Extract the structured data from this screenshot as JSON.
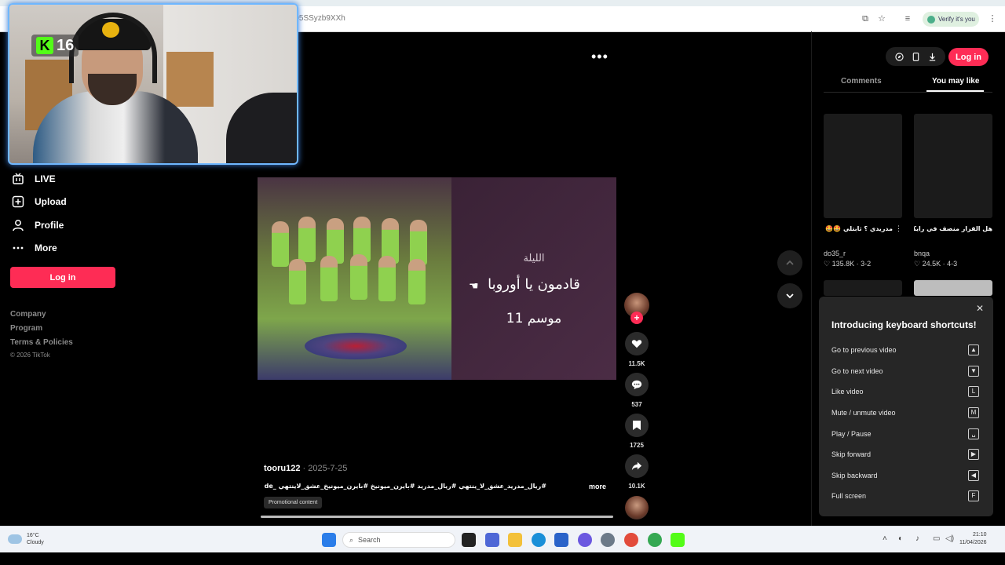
{
  "browser": {
    "url_fragment": "-95SSyzb9XXh",
    "verify_label": "Verify it's you"
  },
  "stream_overlay": {
    "platform_badge": "K",
    "viewer_count": "16"
  },
  "sidebar": {
    "items": [
      {
        "label": "LIVE",
        "icon": "live-tv-icon"
      },
      {
        "label": "Upload",
        "icon": "upload-plus-icon"
      },
      {
        "label": "Profile",
        "icon": "profile-user-icon"
      },
      {
        "label": "More",
        "icon": "more-dots-icon"
      }
    ],
    "login_label": "Log in",
    "footer_links": [
      "Company",
      "Program",
      "Terms & Policies"
    ],
    "copyright": "© 2026 TikTok"
  },
  "video": {
    "overlay_lines": [
      "الليلة",
      "قادمون يا أوروبا",
      "موسم 11"
    ],
    "author": "tooru122",
    "date": "2025-7-25",
    "description": "#ريال_مدريد_عشق_لا_ينتهي #ريال_مدريد #بايرن_ميونيخ #بايرن_ميونيخ_عشق_لاينتهي _de ...",
    "more_label": "more",
    "promo_label": "Promotional content",
    "progress_fraction": 1.0
  },
  "actions": {
    "likes": "11.5K",
    "comments": "537",
    "saves": "1725",
    "shares": "10.1K"
  },
  "right_panel": {
    "login_label": "Log in",
    "tabs": [
      "Comments",
      "You may like"
    ],
    "active_tab": "You may like",
    "cards": [
      {
        "title": "مدريدي ؟ ثابتلي 🤩🤩 #football...",
        "author": "do35_r",
        "stats": "♡ 135.8K · 3-2"
      },
      {
        "title": "هل القرار منصف في رايكم 🤔 ...",
        "author": "bnqa",
        "stats": "♡ 24.5K · 4-3"
      }
    ]
  },
  "shortcuts_popup": {
    "title": "Introducing keyboard shortcuts!",
    "rows": [
      {
        "label": "Go to previous video",
        "key": "▲"
      },
      {
        "label": "Go to next video",
        "key": "▼"
      },
      {
        "label": "Like video",
        "key": "L"
      },
      {
        "label": "Mute / unmute video",
        "key": "M"
      },
      {
        "label": "Play / Pause",
        "key": "␣"
      },
      {
        "label": "Skip forward",
        "key": "▶"
      },
      {
        "label": "Skip backward",
        "key": "◀"
      },
      {
        "label": "Full screen",
        "key": "F"
      }
    ]
  },
  "taskbar": {
    "temperature": "16°C",
    "weather": "Cloudy",
    "search_placeholder": "Search",
    "time": "21:10",
    "date": "11/04/2026"
  },
  "colors": {
    "accent": "#fe2c55",
    "kick_green": "#53fc18",
    "panel": "#262626"
  }
}
